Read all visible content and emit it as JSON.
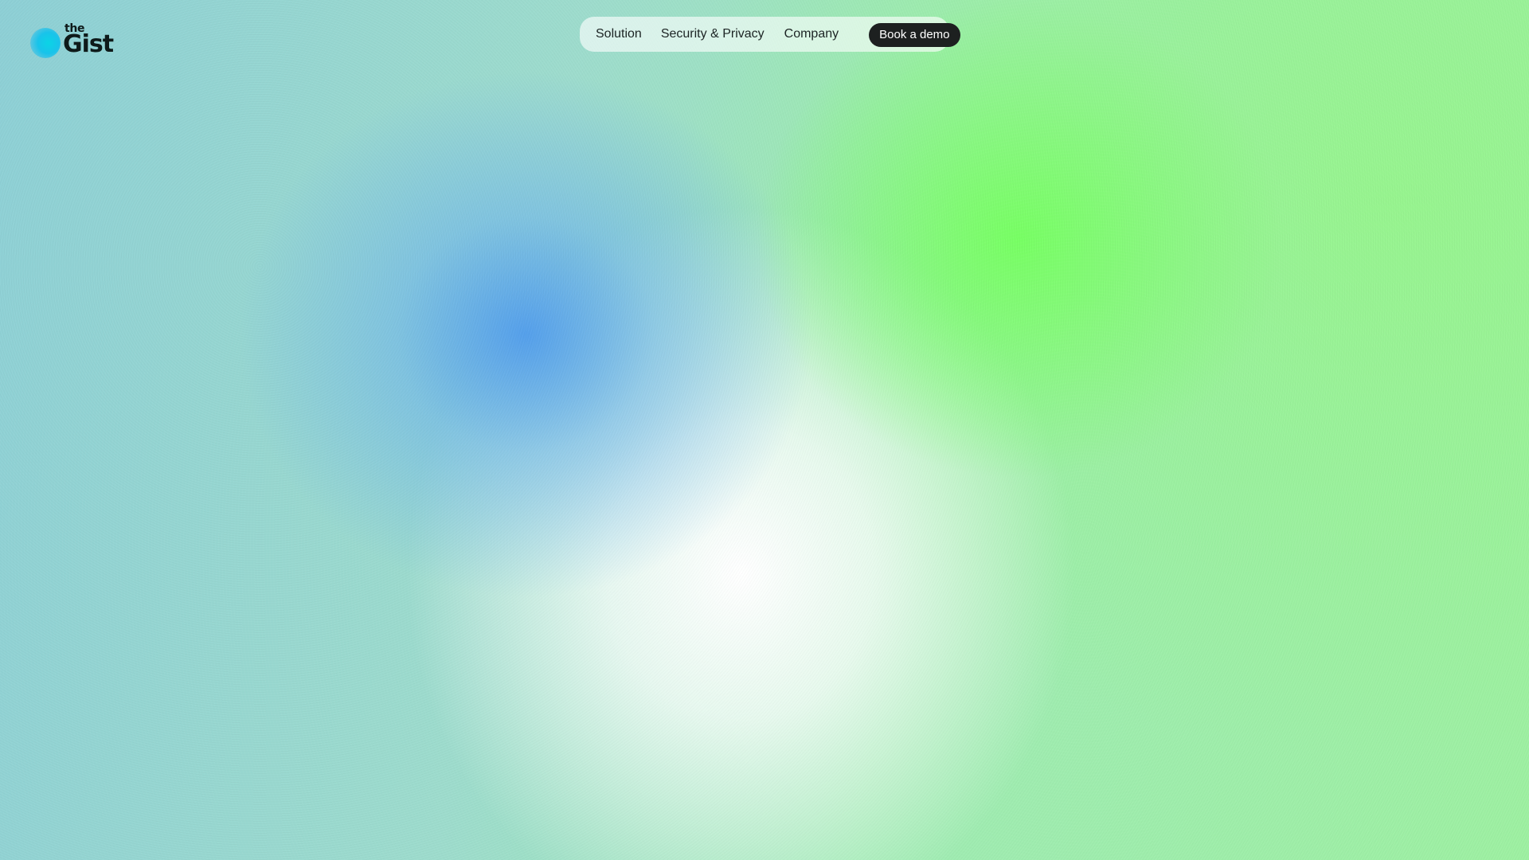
{
  "brand": {
    "name_small": "the",
    "name_large": "Gist",
    "accent_color": "#19c3ea"
  },
  "nav": {
    "links": [
      {
        "label": "Solution"
      },
      {
        "label": "Security & Privacy"
      },
      {
        "label": "Company"
      }
    ],
    "cta_label": "Book a demo",
    "cta_color": "#1d2020"
  },
  "background": {
    "style": "grainy gradient",
    "colors": [
      "#8ed0d6",
      "#55a0eb",
      "#78ff64",
      "#ffffff",
      "#9ef0a2"
    ]
  }
}
